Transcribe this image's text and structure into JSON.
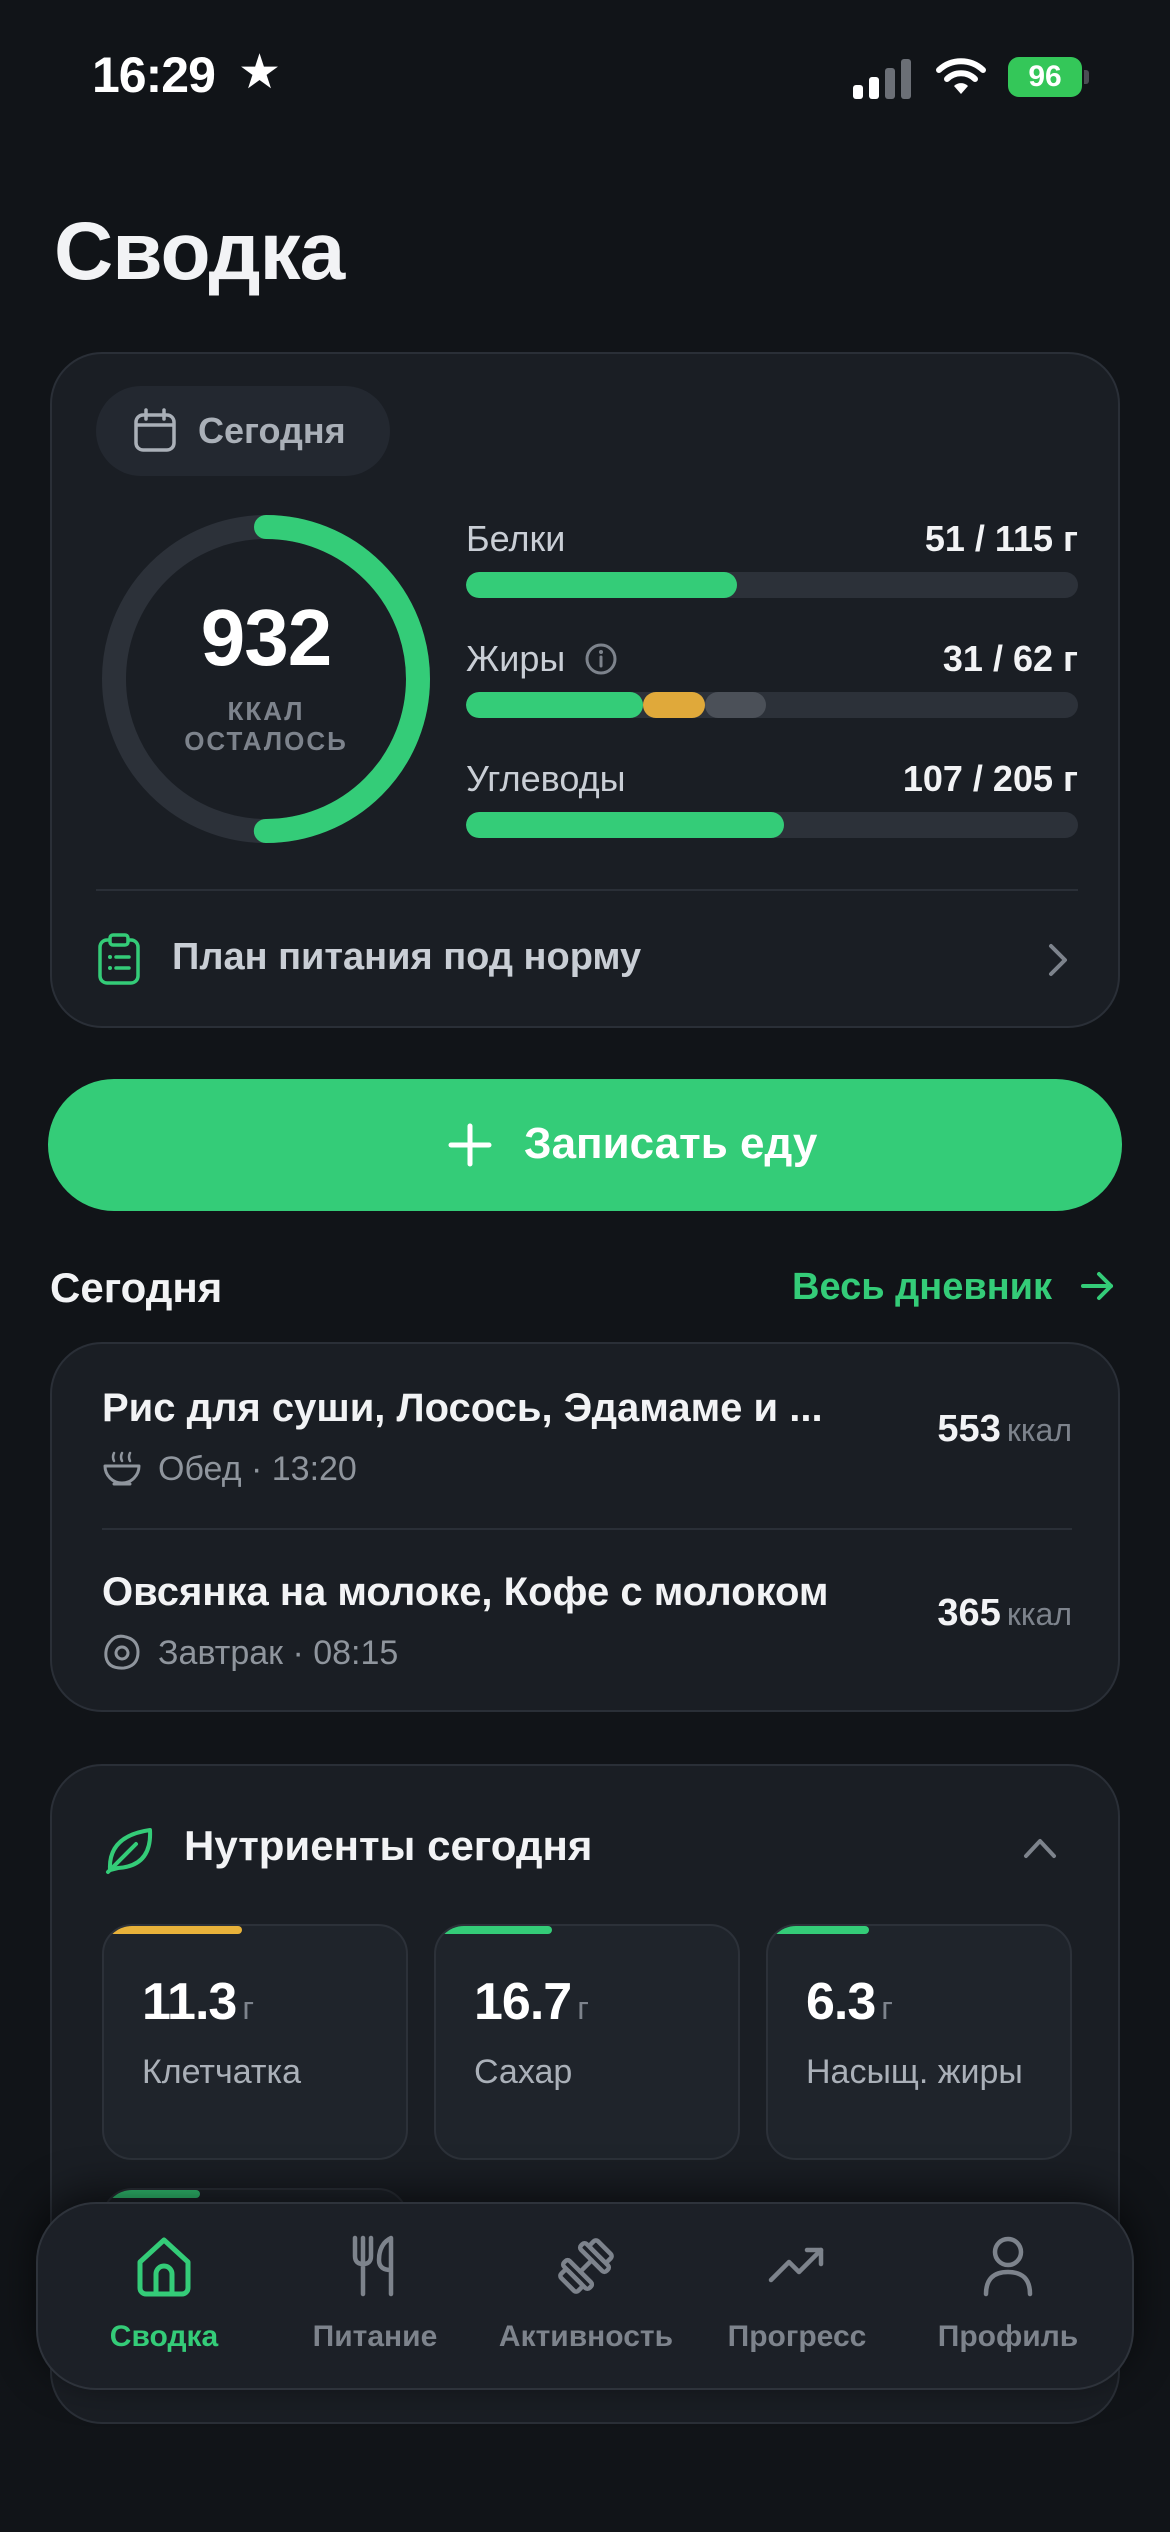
{
  "status_bar": {
    "time": "16:29",
    "star": "★",
    "battery": "96"
  },
  "page": {
    "title": "Сводка"
  },
  "summary": {
    "date_label": "Сегодня",
    "calories_left": "932",
    "calories_unit": "ККАЛ",
    "calories_caption": "ОСТАЛОСЬ",
    "calories_ring_fraction": 0.5,
    "macros": [
      {
        "name": "Белки",
        "value": "51 / 115 г",
        "fraction": 0.443
      },
      {
        "name": "Жиры",
        "value": "31 / 62 г",
        "segments": [
          0.29,
          0.1,
          0.1
        ]
      },
      {
        "name": "Углеводы",
        "value": "107 / 205 г",
        "fraction": 0.52
      }
    ],
    "plan_label": "План питания под норму"
  },
  "log_button": {
    "label": "Записать еду"
  },
  "today": {
    "title": "Сегодня",
    "link": "Весь дневник",
    "meals": [
      {
        "title": "Рис для суши, Лосось, Эдамаме и ...",
        "meta": "Обед · 13:20",
        "kcal": "553",
        "unit": "ккал",
        "icon": "bowl-icon"
      },
      {
        "title": "Овсянка на молоке, Кофе с молоком",
        "meta": "Завтрак · 08:15",
        "kcal": "365",
        "unit": "ккал",
        "icon": "egg-icon"
      }
    ]
  },
  "nutrients": {
    "title": "Нутриенты сегодня",
    "items": [
      {
        "value": "11.3",
        "unit": "г",
        "name": "Клетчатка",
        "color": "#e8b23a",
        "fraction": 0.45
      },
      {
        "value": "16.7",
        "unit": "г",
        "name": "Сахар",
        "color": "#34cc78",
        "fraction": 0.38
      },
      {
        "value": "6.3",
        "unit": "г",
        "name": "Насыщ. жиры",
        "color": "#34cc78",
        "fraction": 0.33
      }
    ]
  },
  "tabbar": [
    {
      "label": "Сводка",
      "active": true
    },
    {
      "label": "Питание",
      "active": false
    },
    {
      "label": "Активность",
      "active": false
    },
    {
      "label": "Прогресс",
      "active": false
    },
    {
      "label": "Профиль",
      "active": false
    }
  ],
  "colors": {
    "accent": "#34cc78",
    "warning": "#e8b23a",
    "background": "#111418",
    "card": "#1a1e24"
  }
}
